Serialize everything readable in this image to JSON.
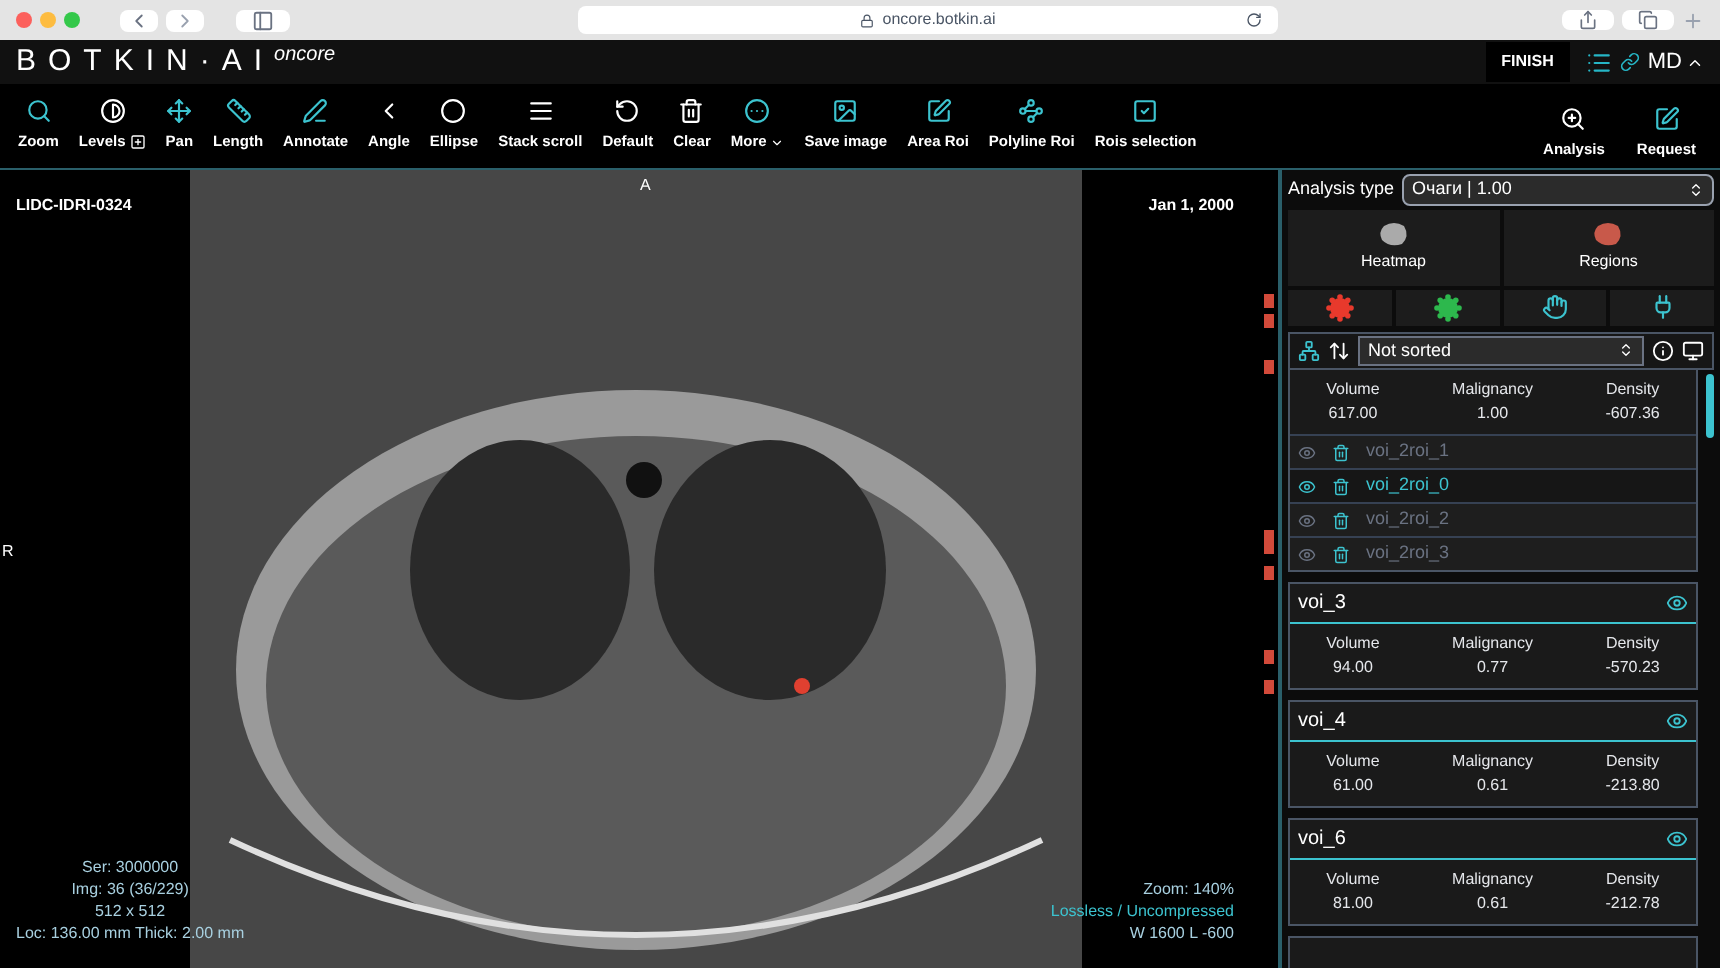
{
  "browser": {
    "url": "oncore.botkin.ai"
  },
  "header": {
    "logo": "BOTKIN·AI",
    "product": "oncore",
    "finish": "FINISH",
    "user": "MD"
  },
  "toolbar": {
    "tools": [
      {
        "label": "Zoom"
      },
      {
        "label": "Levels"
      },
      {
        "label": "Pan"
      },
      {
        "label": "Length"
      },
      {
        "label": "Annotate"
      },
      {
        "label": "Angle"
      },
      {
        "label": "Ellipse"
      },
      {
        "label": "Stack scroll"
      },
      {
        "label": "Default"
      },
      {
        "label": "Clear"
      },
      {
        "label": "More"
      },
      {
        "label": "Save image"
      },
      {
        "label": "Area Roi"
      },
      {
        "label": "Polyline Roi"
      },
      {
        "label": "Rois selection"
      }
    ],
    "actions": [
      {
        "label": "Analysis"
      },
      {
        "label": "Request"
      }
    ]
  },
  "viewer": {
    "patient": "LIDC-IDRI-0324",
    "date": "Jan 1, 2000",
    "orientation_top": "A",
    "orientation_left": "R",
    "bottom_left": [
      "Ser: 3000000",
      "Img: 36 (36/229)",
      "512 x 512",
      "Loc: 136.00 mm Thick: 2.00 mm"
    ],
    "bottom_right": [
      "Zoom: 140%",
      "Lossless / Uncompressed",
      "W 1600 L -600"
    ]
  },
  "panel": {
    "analysis_type_label": "Analysis type",
    "analysis_type": "Очаги | 1.00",
    "views": [
      {
        "label": "Heatmap"
      },
      {
        "label": "Regions"
      }
    ],
    "sort": "Not sorted",
    "vois": [
      {
        "stats": [
          {
            "label": "Volume",
            "value": "617.00"
          },
          {
            "label": "Malignancy",
            "value": "1.00"
          },
          {
            "label": "Density",
            "value": "-607.36"
          }
        ],
        "rois": [
          {
            "name": "voi_2roi_1",
            "selected": false
          },
          {
            "name": "voi_2roi_0",
            "selected": true
          },
          {
            "name": "voi_2roi_2",
            "selected": false
          },
          {
            "name": "voi_2roi_3",
            "selected": false
          }
        ]
      },
      {
        "name": "voi_3",
        "stats": [
          {
            "label": "Volume",
            "value": "94.00"
          },
          {
            "label": "Malignancy",
            "value": "0.77"
          },
          {
            "label": "Density",
            "value": "-570.23"
          }
        ]
      },
      {
        "name": "voi_4",
        "stats": [
          {
            "label": "Volume",
            "value": "61.00"
          },
          {
            "label": "Malignancy",
            "value": "0.61"
          },
          {
            "label": "Density",
            "value": "-213.80"
          }
        ]
      },
      {
        "name": "voi_6",
        "stats": [
          {
            "label": "Volume",
            "value": "81.00"
          },
          {
            "label": "Malignancy",
            "value": "0.61"
          },
          {
            "label": "Density",
            "value": "-212.78"
          }
        ]
      }
    ]
  }
}
